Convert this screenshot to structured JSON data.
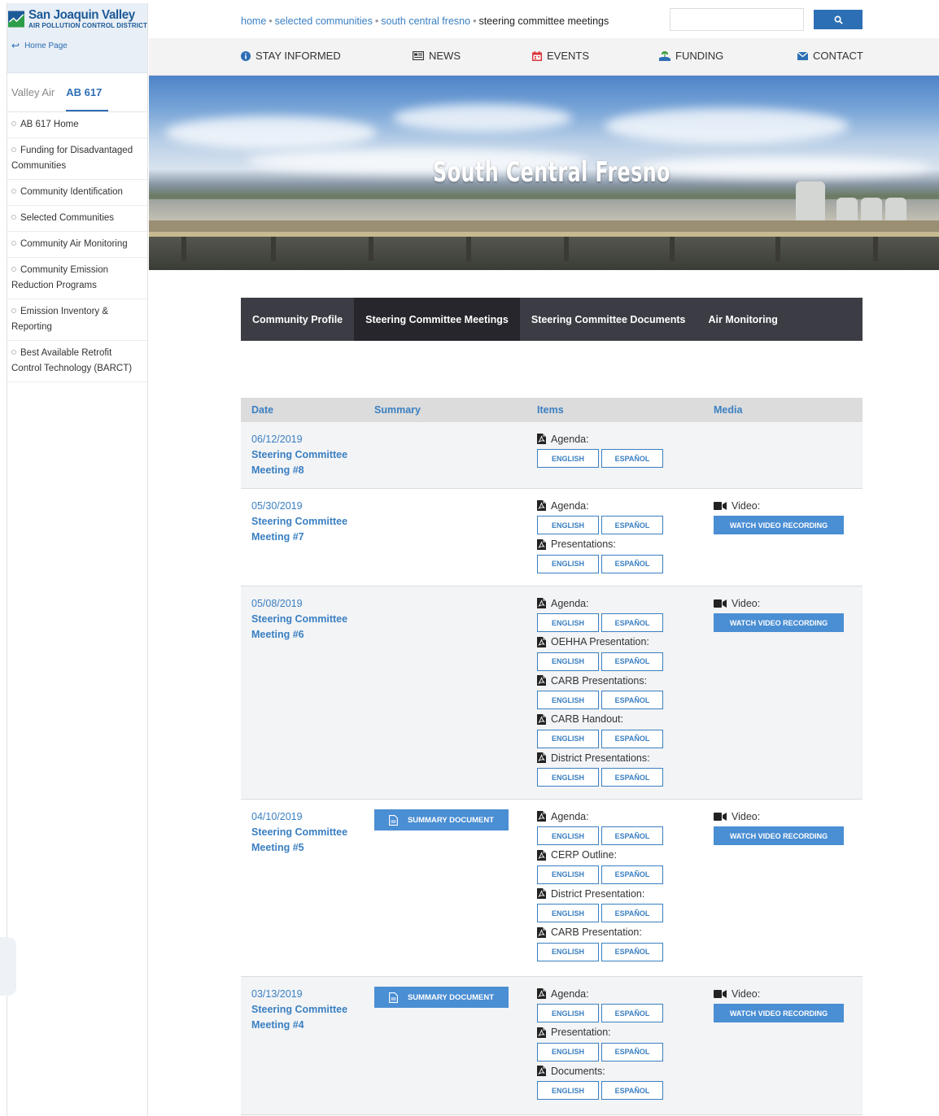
{
  "logo": {
    "line1": "San Joaquin Valley",
    "line2": "AIR POLLUTION CONTROL DISTRICT"
  },
  "sidebar": {
    "homepage": "Home Page",
    "tabs": [
      {
        "label": "Valley Air"
      },
      {
        "label": "AB 617"
      }
    ],
    "items": [
      {
        "label": "AB 617 Home"
      },
      {
        "label": "Funding for Disadvantaged Communities"
      },
      {
        "label": "Community Identification"
      },
      {
        "label": "Selected Communities"
      },
      {
        "label": "Community Air Monitoring"
      },
      {
        "label": "Community Emission Reduction Programs"
      },
      {
        "label": "Emission Inventory & Reporting"
      },
      {
        "label": "Best Available Retrofit Control Technology (BARCT)"
      }
    ]
  },
  "breadcrumb": {
    "home": "home",
    "selected": "selected communities",
    "community": "south central fresno",
    "current": "steering committee meetings"
  },
  "search": {
    "placeholder": ""
  },
  "nav": {
    "stay_informed": "STAY INFORMED",
    "news": "NEWS",
    "events": "EVENTS",
    "funding": "FUNDING",
    "contact": "CONTACT"
  },
  "hero": {
    "title": "South Central Fresno"
  },
  "tabs": {
    "profile": "Community Profile",
    "meetings": "Steering Committee Meetings",
    "documents": "Steering Committee Documents",
    "monitoring": "Air Monitoring"
  },
  "table": {
    "headers": {
      "date": "Date",
      "summary": "Summary",
      "items": "Items",
      "media": "Media"
    },
    "english": "ENGLISH",
    "espanol": "ESPAÑOL",
    "summary_label": "SUMMARY DOCUMENT",
    "video_label": "Video:",
    "watch_label": "WATCH VIDEO RECORDING",
    "rows": [
      {
        "date": "06/12/2019",
        "title1": "Steering Committee",
        "title2": "Meeting #8",
        "items": [
          "Agenda:"
        ]
      },
      {
        "date": "05/30/2019",
        "title1": "Steering Committee",
        "title2": "Meeting #7",
        "items": [
          "Agenda:",
          "Presentations:"
        ]
      },
      {
        "date": "05/08/2019",
        "title1": "Steering Committee",
        "title2": "Meeting #6",
        "items": [
          "Agenda:",
          "OEHHA Presentation:",
          "CARB Presentations:",
          "CARB Handout:",
          "District Presentations:"
        ]
      },
      {
        "date": "04/10/2019",
        "title1": "Steering Committee",
        "title2": "Meeting #5",
        "items": [
          "Agenda:",
          "CERP Outline:",
          "District Presentation:",
          "CARB Presentation:"
        ]
      },
      {
        "date": "03/13/2019",
        "title1": "Steering Committee",
        "title2": "Meeting #4",
        "items": [
          "Agenda:",
          "Presentation:",
          "Documents:"
        ]
      }
    ]
  },
  "colors": {
    "accent": "#2d6fb5",
    "link": "#3a7fc1",
    "tab_bg": "#3c3c44",
    "tab_active": "#26262c",
    "button": "#4a8ed3"
  }
}
